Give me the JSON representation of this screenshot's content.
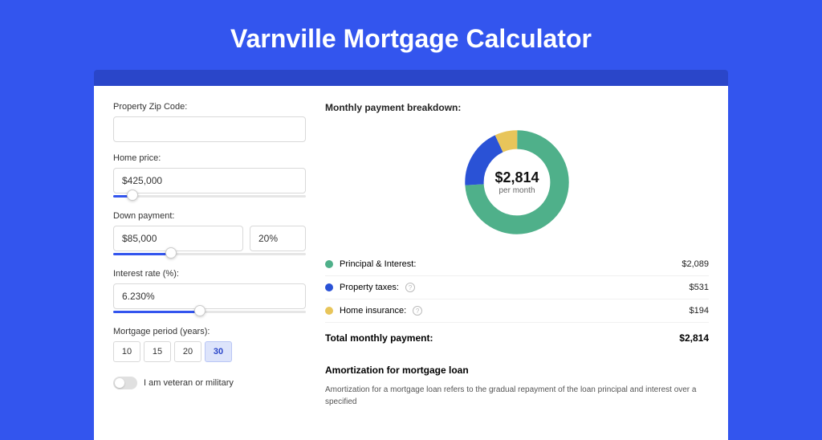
{
  "title": "Varnville Mortgage Calculator",
  "form": {
    "zip": {
      "label": "Property Zip Code:",
      "value": ""
    },
    "price": {
      "label": "Home price:",
      "value": "$425,000",
      "slider_pct": 10
    },
    "down": {
      "label": "Down payment:",
      "amount": "$85,000",
      "pct": "20%",
      "slider_pct": 30
    },
    "rate": {
      "label": "Interest rate (%):",
      "value": "6.230%",
      "slider_pct": 45
    },
    "period": {
      "label": "Mortgage period (years):",
      "options": [
        "10",
        "15",
        "20",
        "30"
      ],
      "selected": "30"
    },
    "veteran": {
      "label": "I am veteran or military",
      "on": false
    }
  },
  "breakdown": {
    "title": "Monthly payment breakdown:",
    "center_amount": "$2,814",
    "center_sub": "per month",
    "items": [
      {
        "key": "principal",
        "label": "Principal & Interest:",
        "value": "$2,089",
        "color": "green",
        "info": false
      },
      {
        "key": "taxes",
        "label": "Property taxes:",
        "value": "$531",
        "color": "blue",
        "info": true
      },
      {
        "key": "insurance",
        "label": "Home insurance:",
        "value": "$194",
        "color": "yellow",
        "info": true
      }
    ],
    "total_label": "Total monthly payment:",
    "total_value": "$2,814"
  },
  "amortization": {
    "title": "Amortization for mortgage loan",
    "text": "Amortization for a mortgage loan refers to the gradual repayment of the loan principal and interest over a specified"
  },
  "chart_data": {
    "type": "pie",
    "title": "Monthly payment breakdown",
    "series": [
      {
        "name": "Principal & Interest",
        "value": 2089,
        "color": "#4fb08a"
      },
      {
        "name": "Property taxes",
        "value": 531,
        "color": "#2a52d6"
      },
      {
        "name": "Home insurance",
        "value": 194,
        "color": "#e8c55a"
      }
    ],
    "total": 2814,
    "center_label": "$2,814 per month"
  }
}
